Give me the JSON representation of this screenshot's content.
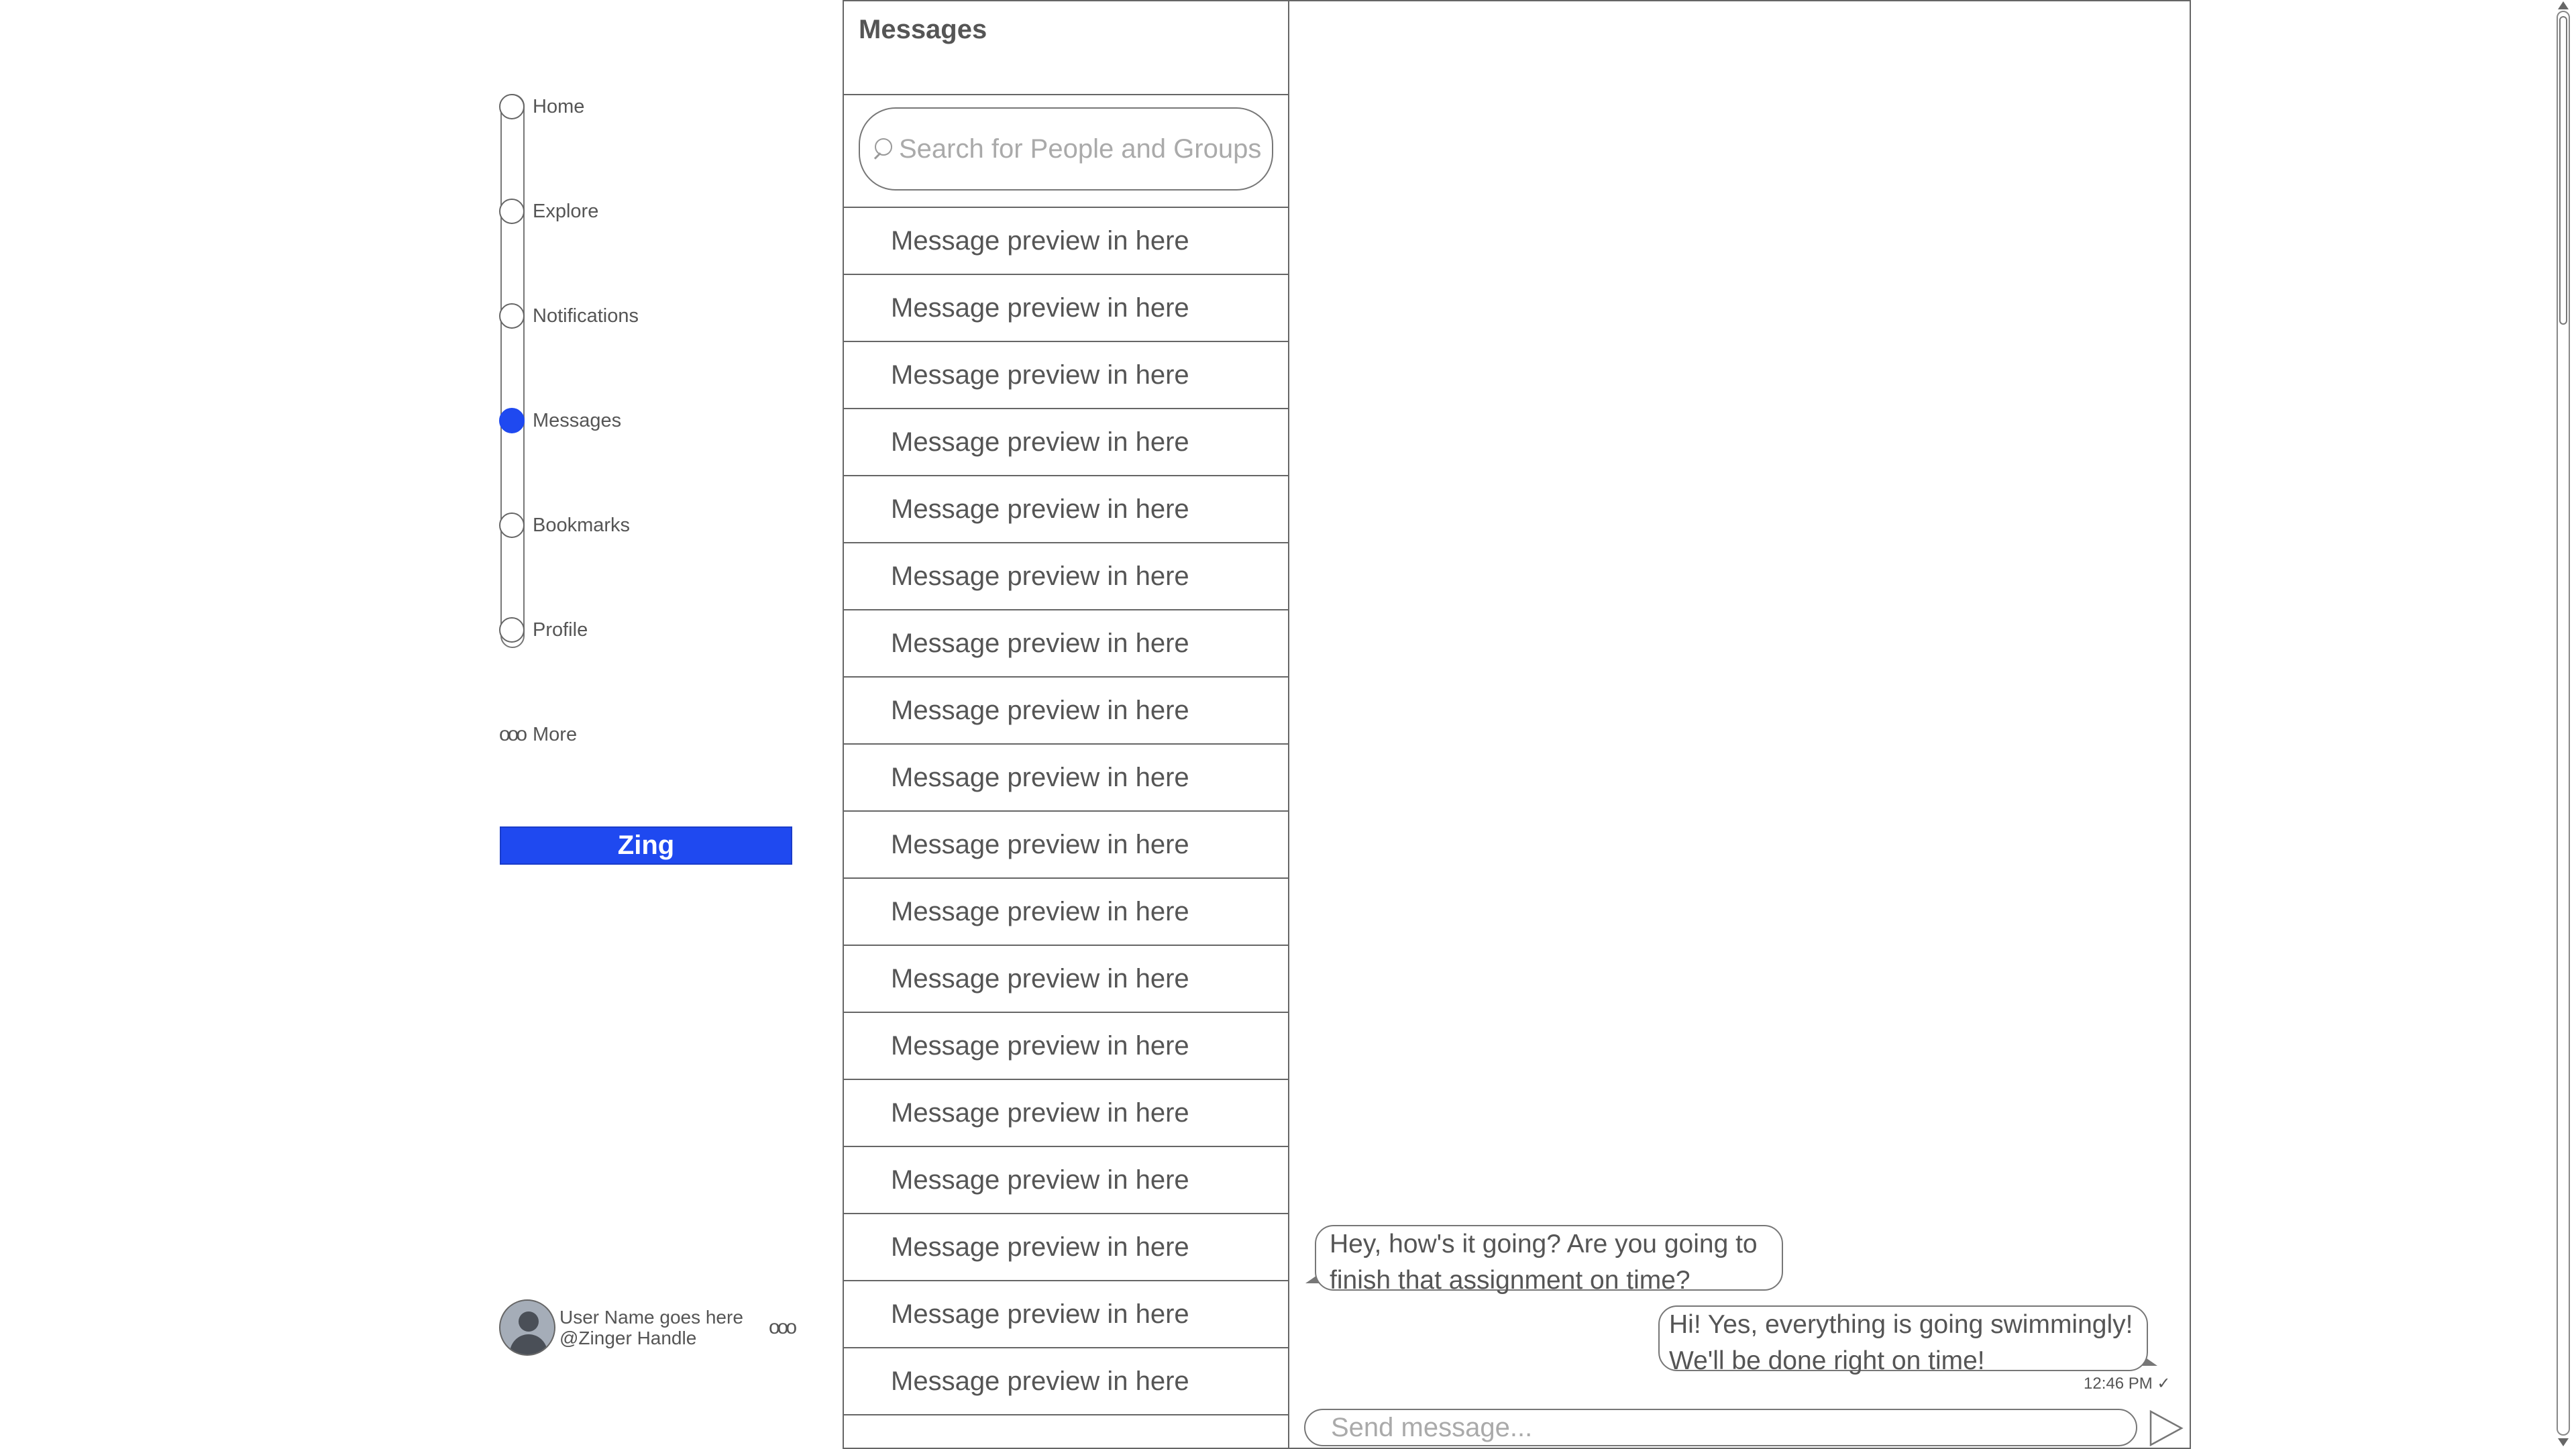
{
  "nav": {
    "items": [
      {
        "label": "Home",
        "active": false
      },
      {
        "label": "Explore",
        "active": false
      },
      {
        "label": "Notifications",
        "active": false
      },
      {
        "label": "Messages",
        "active": true
      },
      {
        "label": "Bookmarks",
        "active": false
      },
      {
        "label": "Profile",
        "active": false
      }
    ],
    "more_label": "More",
    "more_icon": "ooo",
    "zing_button": "Zing",
    "accent_color": "#1f49f0"
  },
  "user": {
    "name": "User Name goes here",
    "handle": "@Zinger Handle",
    "more_icon": "ooo"
  },
  "messages_panel": {
    "title": "Messages",
    "search_placeholder": "Search for People and Groups",
    "previews": [
      "Message preview in here",
      "Message preview in here",
      "Message preview in here",
      "Message preview in here",
      "Message preview in here",
      "Message preview in here",
      "Message preview in here",
      "Message preview in here",
      "Message preview in here",
      "Message preview in here",
      "Message preview in here",
      "Message preview in here",
      "Message preview in here",
      "Message preview in here",
      "Message preview in here",
      "Message preview in here",
      "Message preview in here",
      "Message preview in here"
    ]
  },
  "conversation": {
    "incoming": {
      "line1": "Hey, how's it going? Are you going to",
      "line2": "finish that assignment on time?"
    },
    "outgoing": {
      "line1": "Hi! Yes, everything is going swimmingly!",
      "line2": "We'll be done right on time!"
    },
    "timestamp": "12:46 PM ✓",
    "compose_placeholder": "Send message..."
  }
}
